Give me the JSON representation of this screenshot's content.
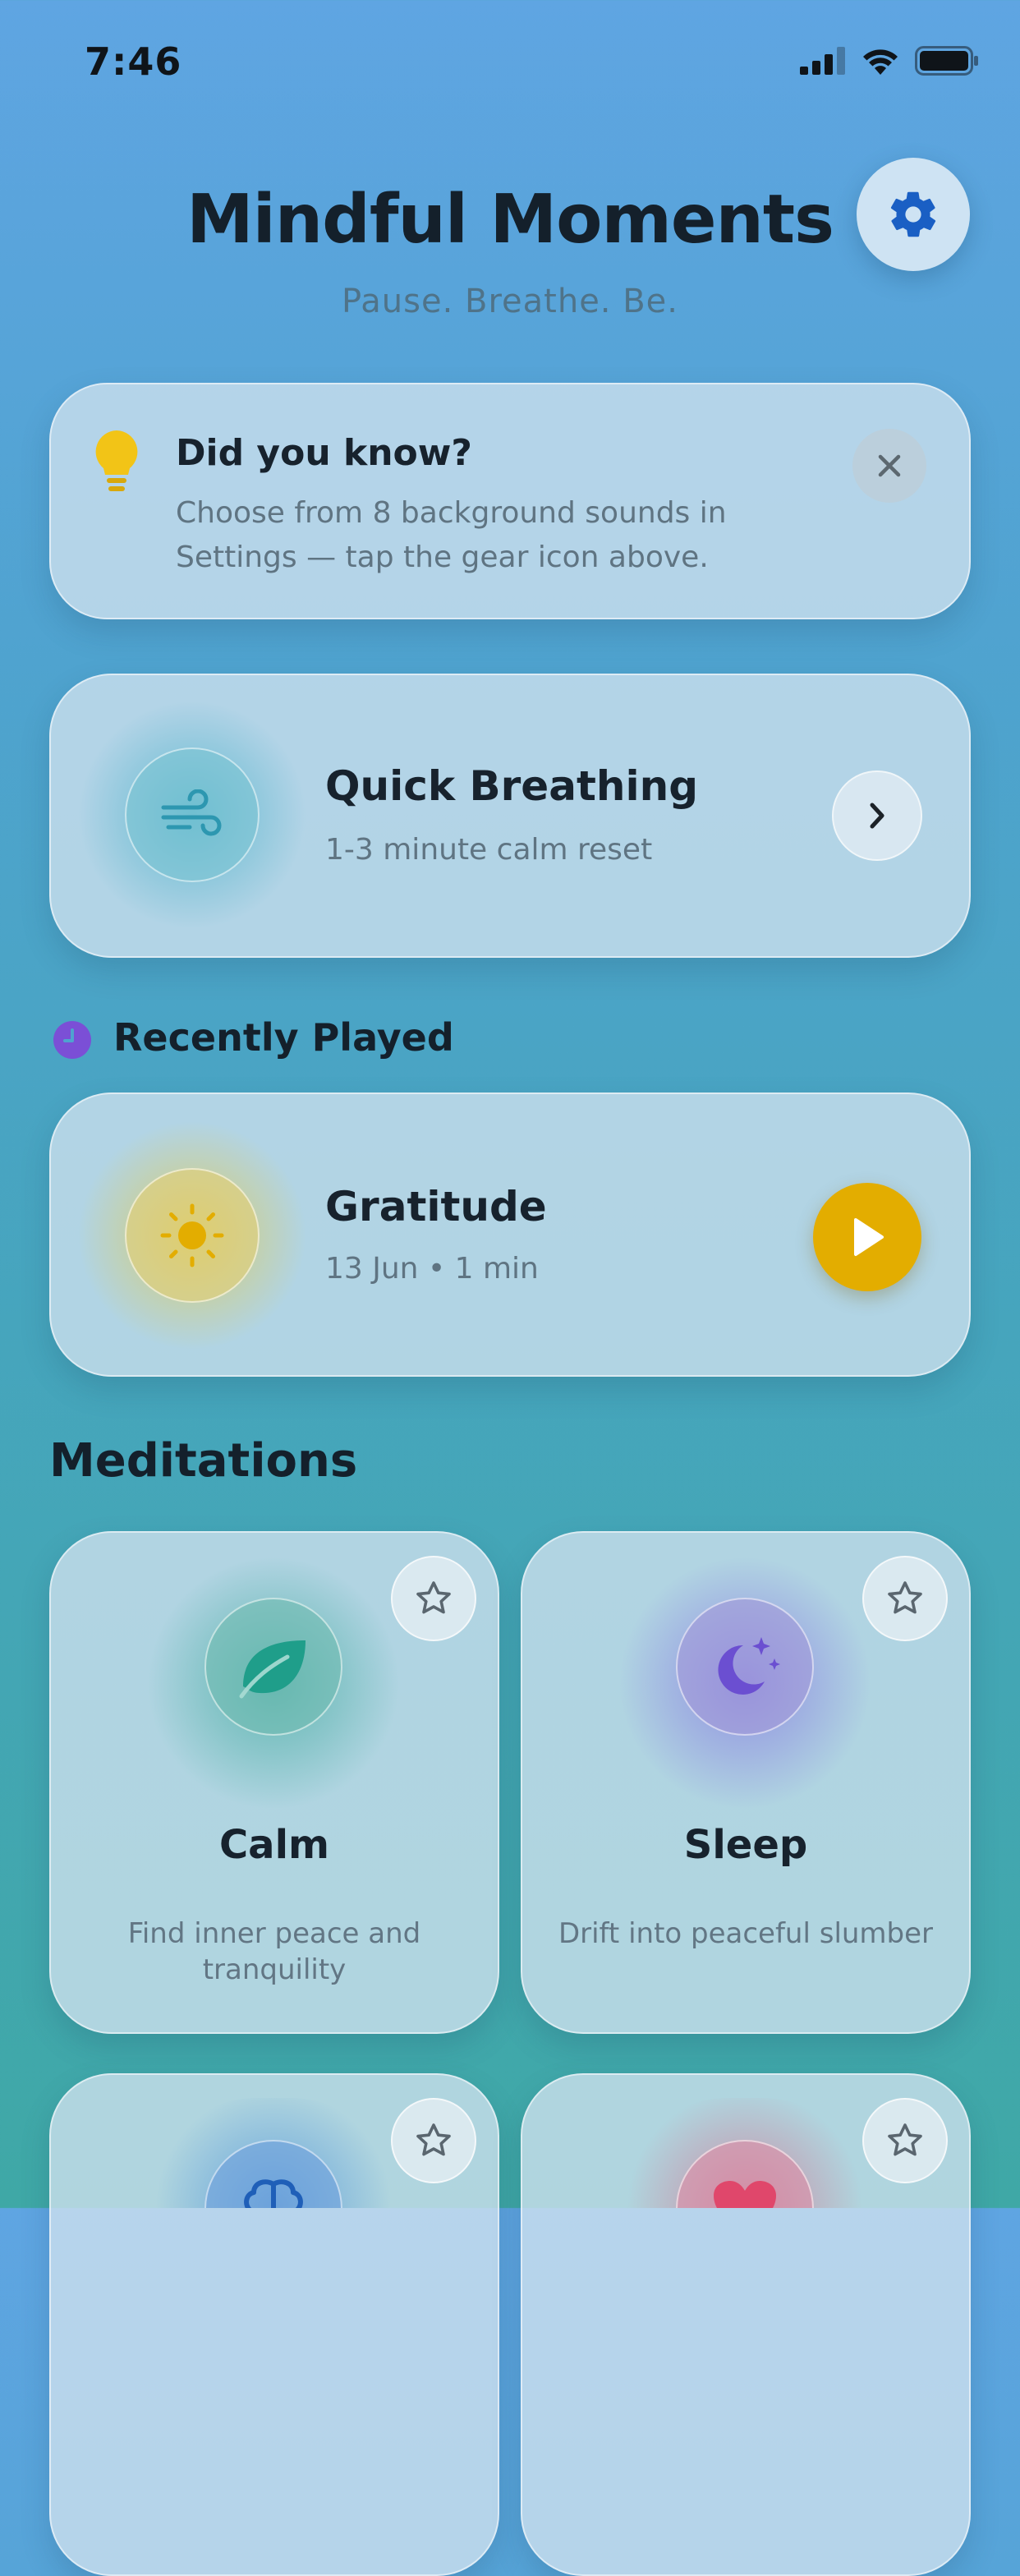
{
  "status_bar": {
    "time": "7:46"
  },
  "header": {
    "title": "Mindful Moments",
    "subtitle": "Pause. Breathe. Be."
  },
  "tip": {
    "title": "Did you know?",
    "text": "Choose from 8 background sounds in Settings — tap the gear icon above."
  },
  "quick_breathing": {
    "title": "Quick Breathing",
    "subtitle": "1-3 minute calm reset"
  },
  "recently_played": {
    "heading": "Recently Played",
    "item": {
      "title": "Gratitude",
      "meta": "13 Jun • 1 min"
    }
  },
  "meditations": {
    "heading": "Meditations",
    "items": [
      {
        "title": "Calm",
        "description": "Find inner peace and tranquility",
        "color": "#1f9e8a",
        "icon": "leaf-icon"
      },
      {
        "title": "Sleep",
        "description": "Drift into peaceful slumber",
        "color": "#6b4fd1",
        "icon": "moon-stars-icon"
      },
      {
        "title": "",
        "description": "",
        "color": "#2f7fd6",
        "icon": "brain-icon"
      },
      {
        "title": "",
        "description": "",
        "color": "#e0476b",
        "icon": "heart-icon"
      }
    ]
  },
  "colors": {
    "accent_gear": "#1a5fc4",
    "play_button": "#e3ad00",
    "recent_icon": "#7b4fd6"
  }
}
